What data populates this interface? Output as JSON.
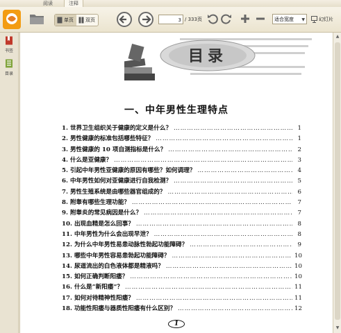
{
  "tabs": [
    "阅读",
    "注释"
  ],
  "view_modes": {
    "single": "单页",
    "double": "双页"
  },
  "navigation": {
    "current_page": "3",
    "total_pages": "/ 333页"
  },
  "zoom": {
    "selected": "适合宽度"
  },
  "slideshow_label": "幻灯片",
  "sidebar": {
    "bookmarks": "书签",
    "contents": "目录"
  },
  "document": {
    "banner_title": "目录",
    "section_title": "一、中年男性生理特点",
    "entries": [
      {
        "title": "1. 世界卫生组织关于健康的定义是什么？",
        "page": "1"
      },
      {
        "title": "2. 男性健康的标准包括哪些特征？",
        "page": "1"
      },
      {
        "title": "3. 男性健康的 10 项自测指标是什么？",
        "page": "2"
      },
      {
        "title": "4. 什么是亚健康？",
        "page": "3"
      },
      {
        "title": "5. 引起中年男性亚健康的原因有哪些？如何调理？",
        "page": "4"
      },
      {
        "title": "6. 中年男性如何对亚健康进行自我检测？",
        "page": "5"
      },
      {
        "title": "7. 男性生殖系统是由哪些器官组成的？",
        "page": "6"
      },
      {
        "title": "8. 附睾有哪些生理功能？",
        "page": "7"
      },
      {
        "title": "9. 附睾炎的常见病因是什么？",
        "page": "7"
      },
      {
        "title": "10. 出现血精是怎么回事？",
        "page": "8"
      },
      {
        "title": "11. 中年男性为什么会出现早泄？",
        "page": "8"
      },
      {
        "title": "12. 为什么中年男性易患动脉性勃起功能障碍？",
        "page": "9"
      },
      {
        "title": "13. 哪些中年男性容易患勃起功能障碍？",
        "page": "10"
      },
      {
        "title": "14. 尿道流出的白色液体都是精液吗？",
        "page": "10"
      },
      {
        "title": "15. 如何正确判断阳痿？",
        "page": "10"
      },
      {
        "title": "16. 什么是“新阳痿”？",
        "page": "11"
      },
      {
        "title": "17. 如何对待精神性阳痿？",
        "page": "11"
      },
      {
        "title": "18. 功能性阳痿与器质性阳痿有什么区别？",
        "page": "12"
      }
    ],
    "page_number": "1"
  },
  "colors": {
    "accent_red": "#c0392b",
    "logo_orange": "#f39c12"
  }
}
